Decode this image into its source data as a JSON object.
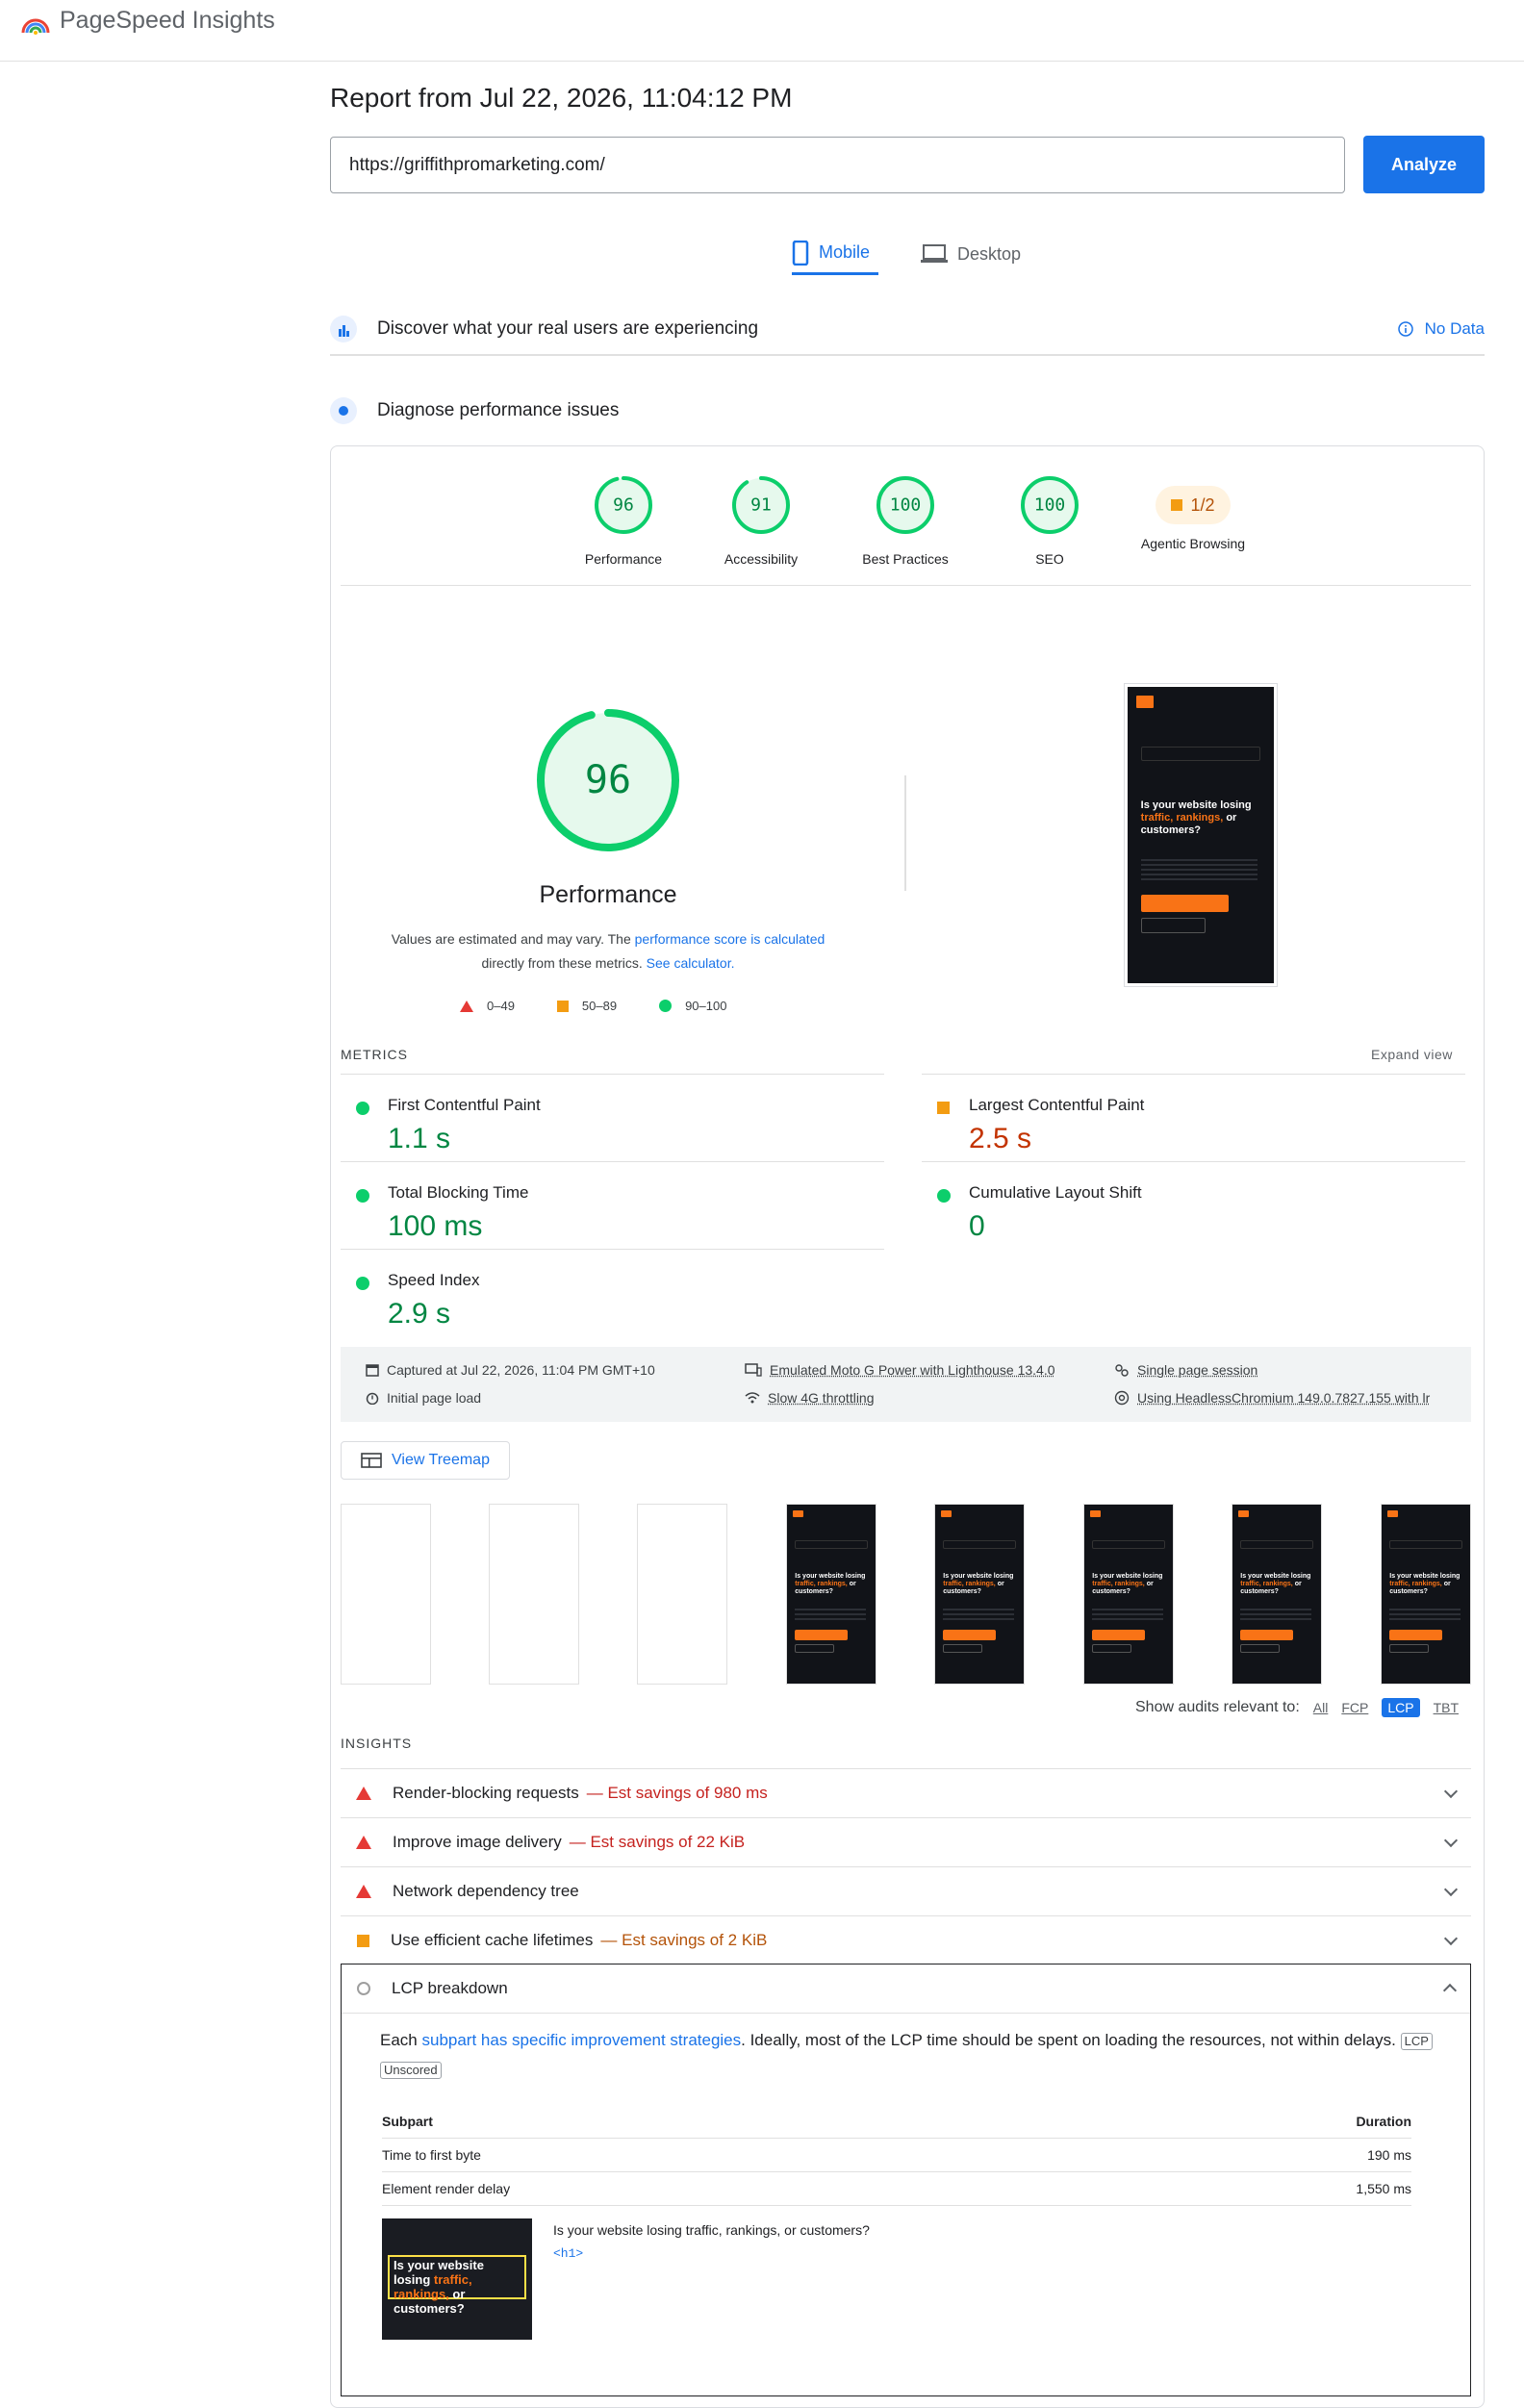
{
  "app": {
    "title": "PageSpeed Insights"
  },
  "report": {
    "title": "Report from Jul 22, 2026, 11:04:12 PM"
  },
  "url_input": {
    "value": "https://griffithpromarketing.com/"
  },
  "analyze_label": "Analyze",
  "tabs": [
    {
      "label": "Mobile",
      "active": true
    },
    {
      "label": "Desktop",
      "active": false
    }
  ],
  "discover": {
    "title": "Discover what your real users are experiencing",
    "status": "No Data"
  },
  "diagnose": {
    "title": "Diagnose performance issues"
  },
  "scores": [
    {
      "value": "96",
      "label": "Performance",
      "score": 96
    },
    {
      "value": "91",
      "label": "Accessibility",
      "score": 91
    },
    {
      "value": "100",
      "label": "Best Practices",
      "score": 100
    },
    {
      "value": "100",
      "label": "SEO",
      "score": 100
    }
  ],
  "agentic": {
    "value": "1/2",
    "label": "Agentic Browsing"
  },
  "performance": {
    "score": "96",
    "score_value": 96,
    "label": "Performance",
    "note_1": "Values are estimated and may vary. The",
    "note_link_1": "performance score is calculated",
    "note_2": "directly from these metrics.",
    "note_link_2": "See calculator."
  },
  "legend": [
    {
      "range": "0–49"
    },
    {
      "range": "50–89"
    },
    {
      "range": "90–100"
    }
  ],
  "metrics": {
    "heading": "METRICS",
    "expand": "Expand view",
    "items": [
      {
        "name": "First Contentful Paint",
        "value": "1.1 s",
        "status": "good"
      },
      {
        "name": "Largest Contentful Paint",
        "value": "2.5 s",
        "status": "average"
      },
      {
        "name": "Total Blocking Time",
        "value": "100 ms",
        "status": "good"
      },
      {
        "name": "Cumulative Layout Shift",
        "value": "0",
        "status": "good"
      },
      {
        "name": "Speed Index",
        "value": "2.9 s",
        "status": "good"
      }
    ]
  },
  "environment": {
    "captured": "Captured at Jul 22, 2026, 11:04 PM GMT+10",
    "load": "Initial page load",
    "device": "Emulated Moto G Power with Lighthouse 13.4.0",
    "throttle": "Slow 4G throttling",
    "session": "Single page session",
    "browser": "Using HeadlessChromium 149.0.7827.155 with lr"
  },
  "treemap_label": "View Treemap",
  "screenshot": {
    "headline_1": "Is your website losing",
    "headline_accent": "traffic, rankings,",
    "headline_2": "or customers?"
  },
  "audit_filter": {
    "label": "Show audits relevant to:",
    "options": [
      "All",
      "FCP",
      "LCP",
      "TBT"
    ],
    "active": "LCP"
  },
  "insights": {
    "heading": "INSIGHTS",
    "items": [
      {
        "title": "Render-blocking requests",
        "savings": "— Est savings of 980 ms",
        "severity": "fail"
      },
      {
        "title": "Improve image delivery",
        "savings": "— Est savings of 22 KiB",
        "severity": "fail"
      },
      {
        "title": "Network dependency tree",
        "savings": "",
        "severity": "fail"
      },
      {
        "title": "Use efficient cache lifetimes",
        "savings": "— Est savings of 2 KiB",
        "severity": "average"
      }
    ]
  },
  "lcp_breakdown": {
    "title": "LCP breakdown",
    "desc_1": "Each",
    "desc_link": "subpart has specific improvement strategies",
    "desc_2": ". Ideally, most of the LCP time should be spent on loading the resources, not within delays.",
    "tag_lcp": "LCP",
    "tag_unscored": "Unscored",
    "col_subpart": "Subpart",
    "col_duration": "Duration",
    "rows": [
      {
        "subpart": "Time to first byte",
        "duration": "190 ms"
      },
      {
        "subpart": "Element render delay",
        "duration": "1,550 ms"
      }
    ],
    "element_text": "Is your website losing traffic, rankings, or customers?",
    "element_tag": "<h1>"
  },
  "colors": {
    "accent": "#1a73e8",
    "good": "#0cce6b",
    "average": "#f39c12",
    "fail": "#e53935"
  }
}
